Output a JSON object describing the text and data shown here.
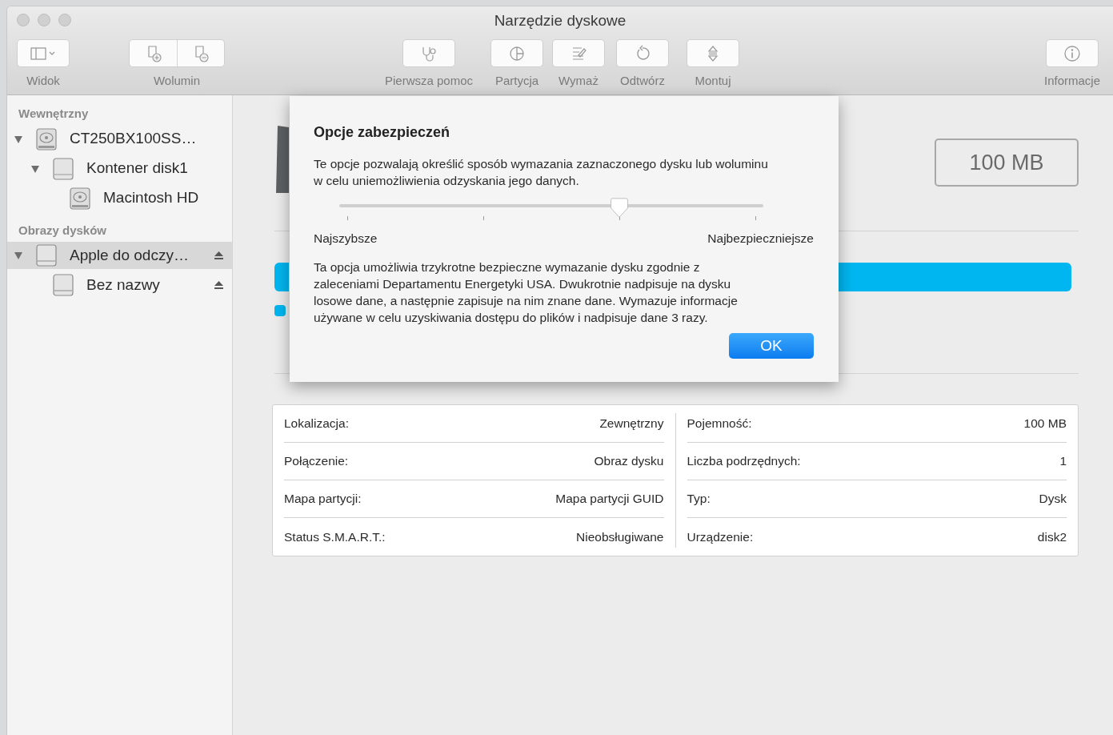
{
  "window": {
    "title": "Narzędzie dyskowe"
  },
  "toolbar": [
    {
      "label": "Widok",
      "kind": "view"
    },
    {
      "label": "Wolumin",
      "kind": "volume"
    },
    {
      "label": "Pierwsza pomoc",
      "kind": "firstaid"
    },
    {
      "label": "Partycja",
      "kind": "partition"
    },
    {
      "label": "Wymaż",
      "kind": "erase"
    },
    {
      "label": "Odtwórz",
      "kind": "restore"
    },
    {
      "label": "Montuj",
      "kind": "mount"
    },
    {
      "label": "Informacje",
      "kind": "info"
    }
  ],
  "sidebar": {
    "sections": [
      {
        "title": "Wewnętrzny",
        "items": [
          {
            "name": "CT250BX100SS…",
            "kind": "hdd",
            "expanded": true,
            "selected": false,
            "ejectable": false,
            "children": [
              {
                "name": "Kontener disk1",
                "kind": "volume",
                "expanded": true,
                "selected": false,
                "ejectable": false,
                "children": [
                  {
                    "name": "Macintosh HD",
                    "kind": "hdd",
                    "selected": false,
                    "ejectable": false
                  }
                ]
              }
            ]
          }
        ]
      },
      {
        "title": "Obrazy dysków",
        "items": [
          {
            "name": "Apple do odczy…",
            "kind": "volume",
            "expanded": true,
            "selected": true,
            "ejectable": true,
            "children": [
              {
                "name": "Bez nazwy",
                "kind": "volume",
                "selected": false,
                "ejectable": true
              }
            ]
          }
        ]
      }
    ]
  },
  "main": {
    "capacity": "100 MB"
  },
  "dialog": {
    "title": "Opcje zabezpieczeń",
    "description": "Te opcje pozwalają określić sposób wymazania zaznaczonego dysku lub woluminu w celu uniemożliwienia odzyskania jego danych.",
    "slider": {
      "level": 0.667,
      "min_label": "Najszybsze",
      "max_label": "Najbezpieczniejsze"
    },
    "detail": "Ta opcja umożliwia trzykrotne bezpieczne wymazanie dysku zgodnie z zaleceniami Departamentu Energetyki USA. Dwukrotnie nadpisuje na dysku losowe dane, a następnie zapisuje na nim znane dane. Wymazuje informacje używane w celu uzyskiwania dostępu do plików i nadpisuje dane 3 razy.",
    "ok_button": "OK"
  },
  "info": {
    "left": [
      {
        "label": "Lokalizacja:",
        "value": "Zewnętrzny"
      },
      {
        "label": "Połączenie:",
        "value": "Obraz dysku"
      },
      {
        "label": "Mapa partycji:",
        "value": "Mapa partycji GUID"
      },
      {
        "label": "Status S.M.A.R.T.:",
        "value": "Nieobsługiwane"
      }
    ],
    "right": [
      {
        "label": "Pojemność:",
        "value": "100 MB"
      },
      {
        "label": "Liczba podrzędnych:",
        "value": "1"
      },
      {
        "label": "Typ:",
        "value": "Dysk"
      },
      {
        "label": "Urządzenie:",
        "value": "disk2"
      }
    ]
  }
}
